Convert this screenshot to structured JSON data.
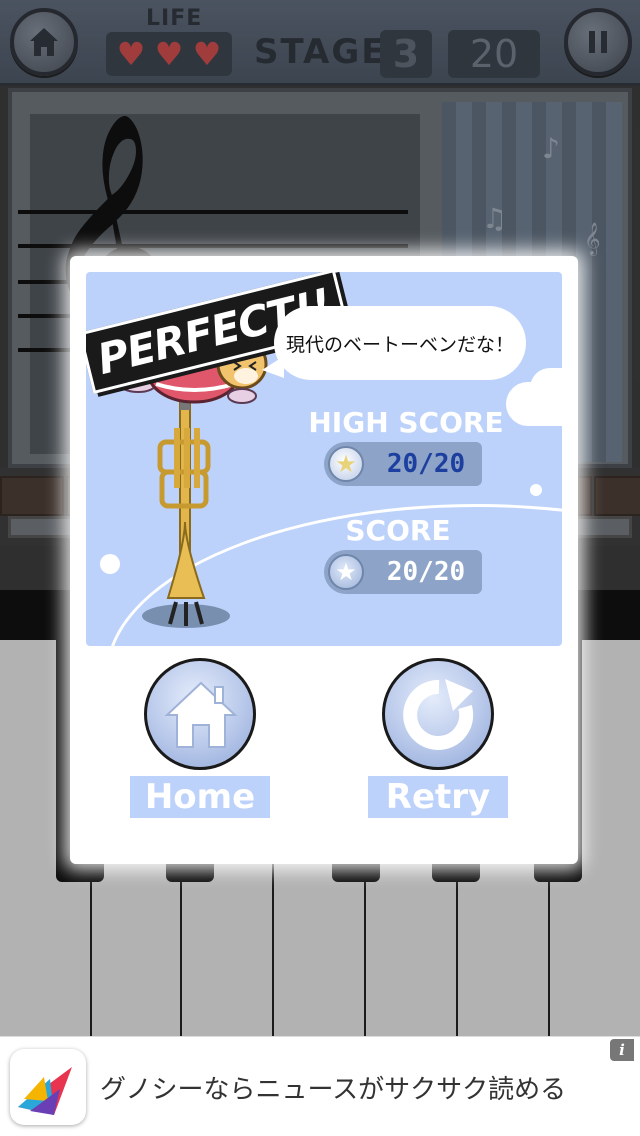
{
  "hud": {
    "life_label": "LIFE",
    "hearts": [
      "♥",
      "♥",
      "♥"
    ],
    "stage_label": "STAGE",
    "stage_number": "3",
    "count": "20",
    "home_icon": "home-icon",
    "pause_icon": "pause-icon"
  },
  "background": {
    "clef_glyph": "𝄞",
    "notes": [
      "♪",
      "♫",
      "𝄞"
    ]
  },
  "result": {
    "badge": "PERFECT!!",
    "speech": "現代のベートーベンだな！",
    "high_score_label": "HIGH SCORE",
    "high_score_value": "20/20",
    "score_label": "SCORE",
    "score_value": "20/20",
    "star_glyph": "★"
  },
  "buttons": {
    "home_label": "Home",
    "retry_label": "Retry"
  },
  "ad": {
    "text": "グノシーならニュースがサクサク読める",
    "info_glyph": "i"
  },
  "colors": {
    "panel_blue": "#bcd2fb",
    "score_blue": "#1d3fa0",
    "heart_red": "#c44a4a"
  }
}
